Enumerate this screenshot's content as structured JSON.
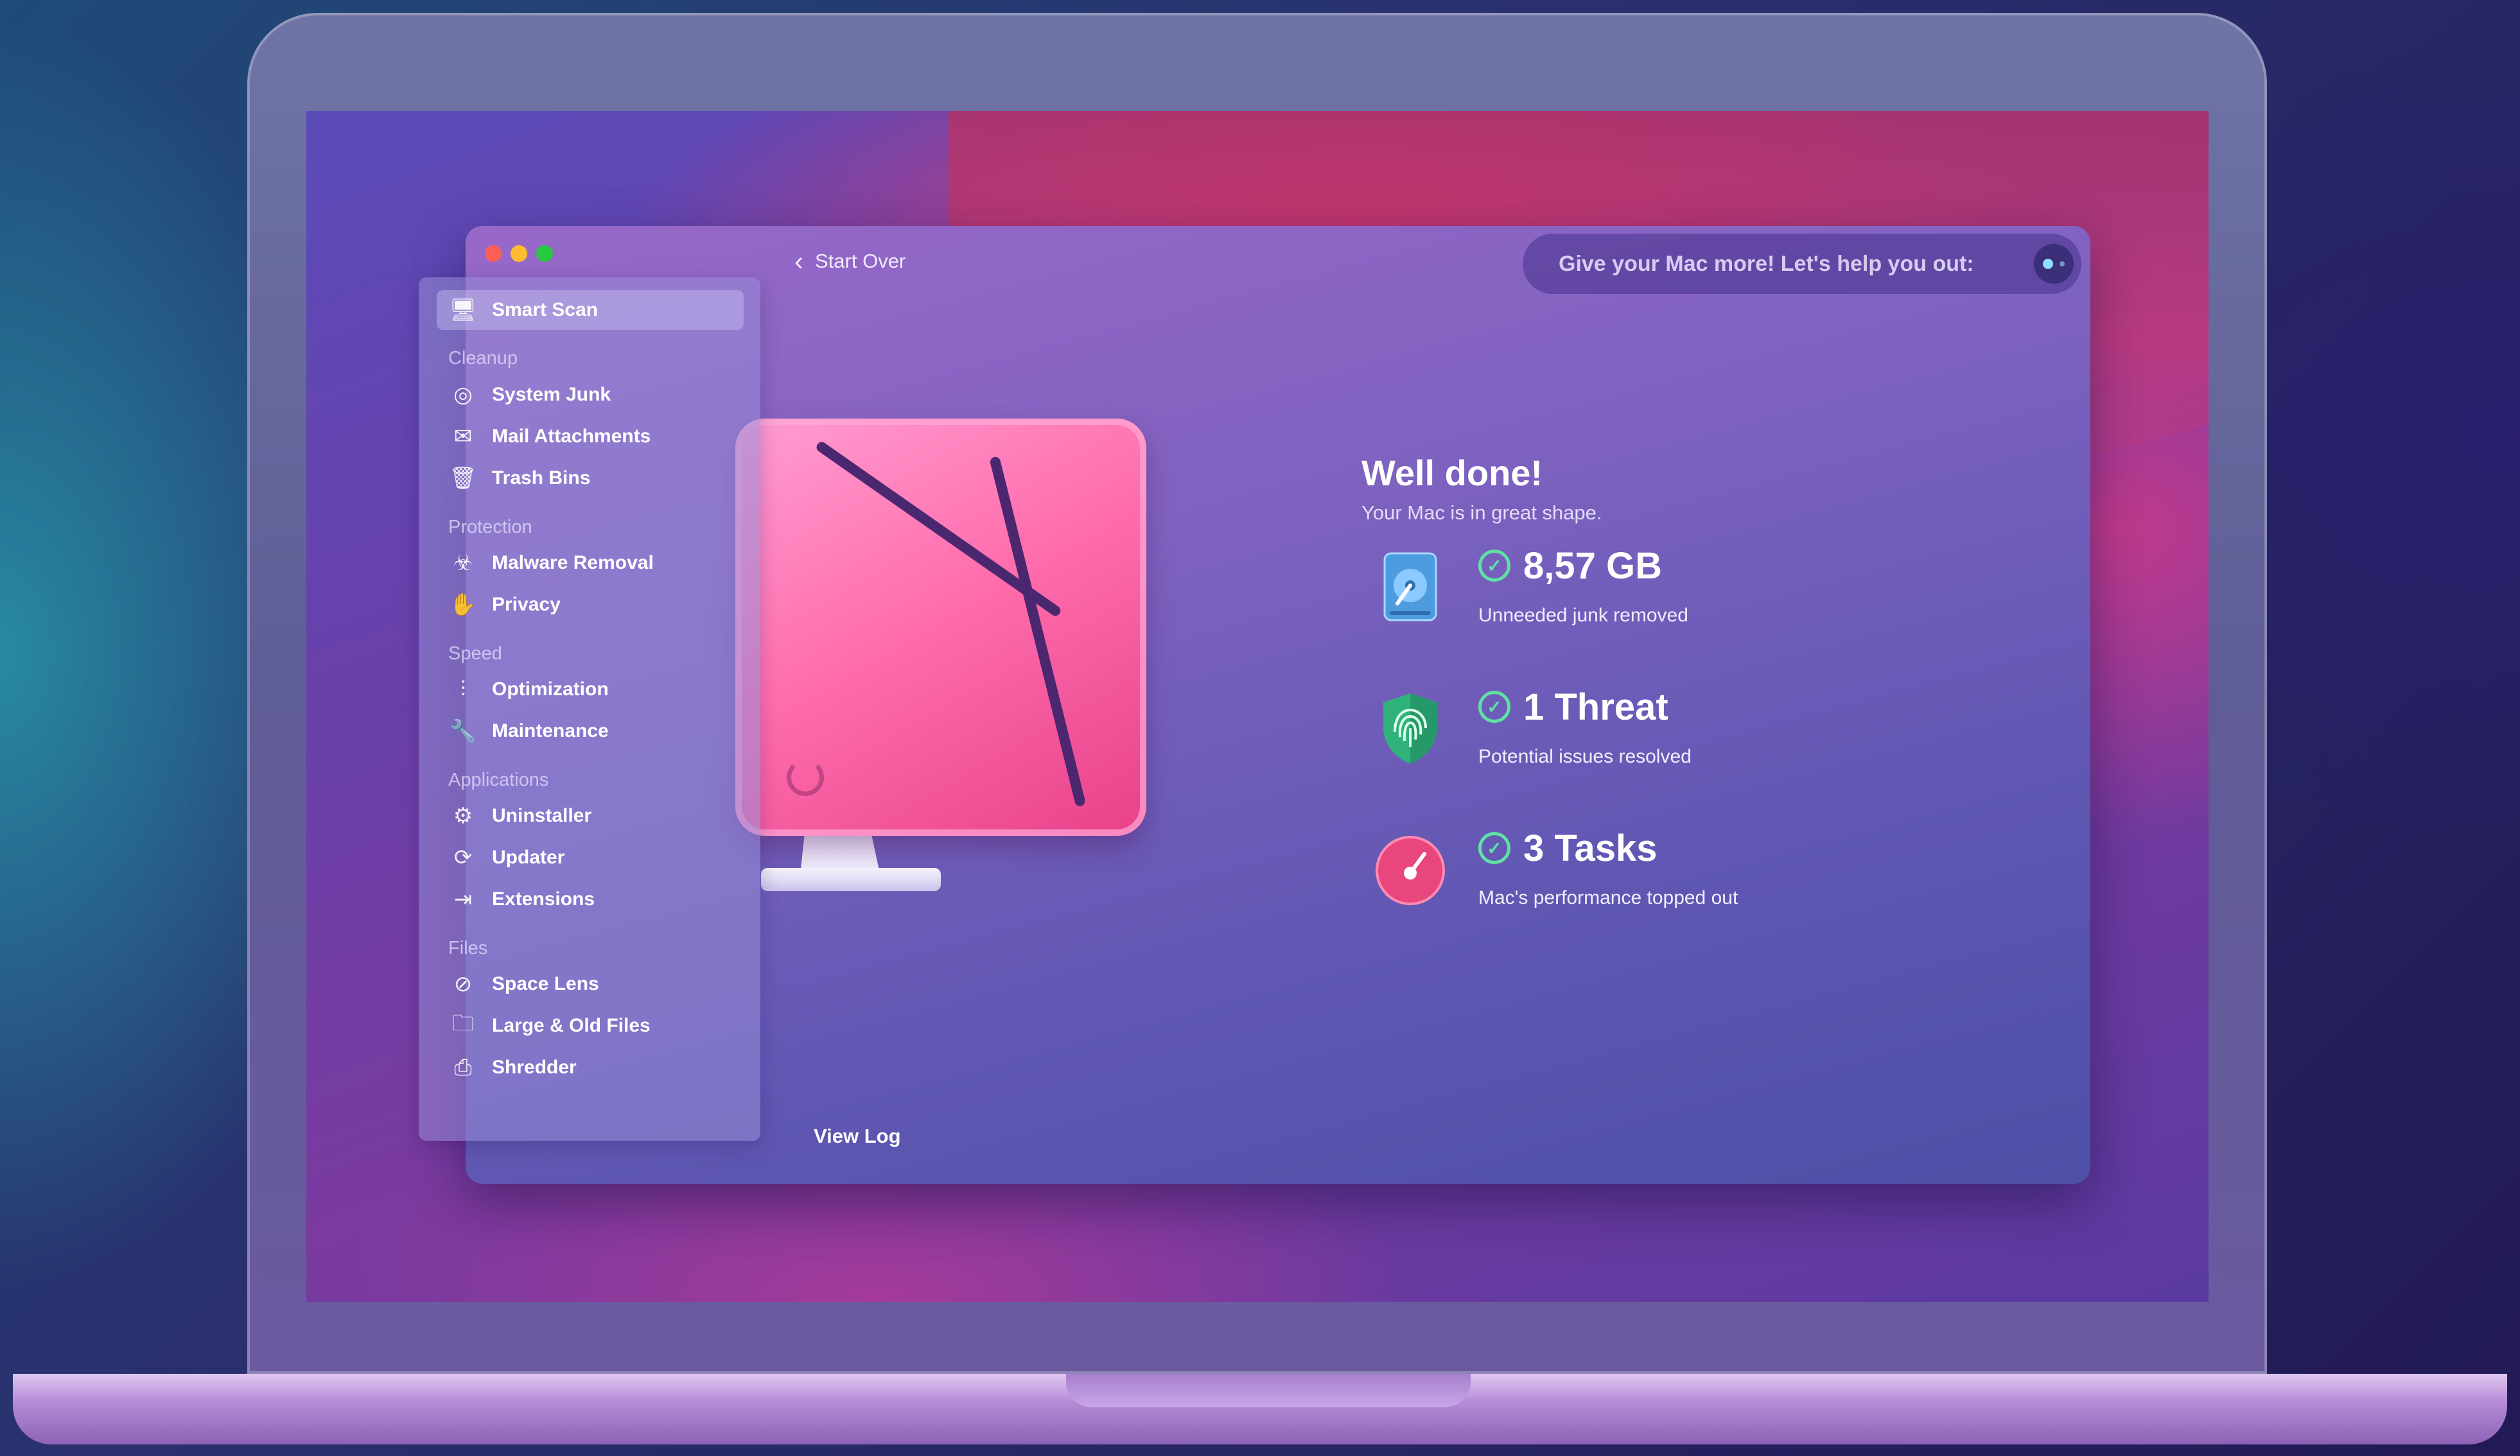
{
  "sidebar": {
    "smart_scan": "Smart Scan",
    "sections": [
      "Cleanup",
      "Protection",
      "Speed",
      "Applications",
      "Files"
    ],
    "cleanup": [
      "System Junk",
      "Mail Attachments",
      "Trash Bins"
    ],
    "protection": [
      "Malware Removal",
      "Privacy"
    ],
    "speed": [
      "Optimization",
      "Maintenance"
    ],
    "applications": [
      "Uninstaller",
      "Updater",
      "Extensions"
    ],
    "files": [
      "Space Lens",
      "Large & Old Files",
      "Shredder"
    ]
  },
  "toolbar": {
    "back_label": "Start Over",
    "promo_text": "Give your Mac more! Let's help you out:"
  },
  "results": {
    "title": "Well done!",
    "subtitle": "Your Mac is in great shape.",
    "stats": [
      {
        "value": "8,57 GB",
        "caption": "Unneeded junk removed",
        "icon": "hard-drive-icon"
      },
      {
        "value": "1 Threat",
        "caption": "Potential issues resolved",
        "icon": "shield-fingerprint-icon"
      },
      {
        "value": "3 Tasks",
        "caption": "Mac's performance topped out",
        "icon": "speedometer-icon"
      }
    ]
  },
  "footer": {
    "view_log": "View Log"
  },
  "colors": {
    "accent_pink": "#ff6fae",
    "check_green": "#5fe1a6",
    "window_purple": "#7f62c0"
  }
}
